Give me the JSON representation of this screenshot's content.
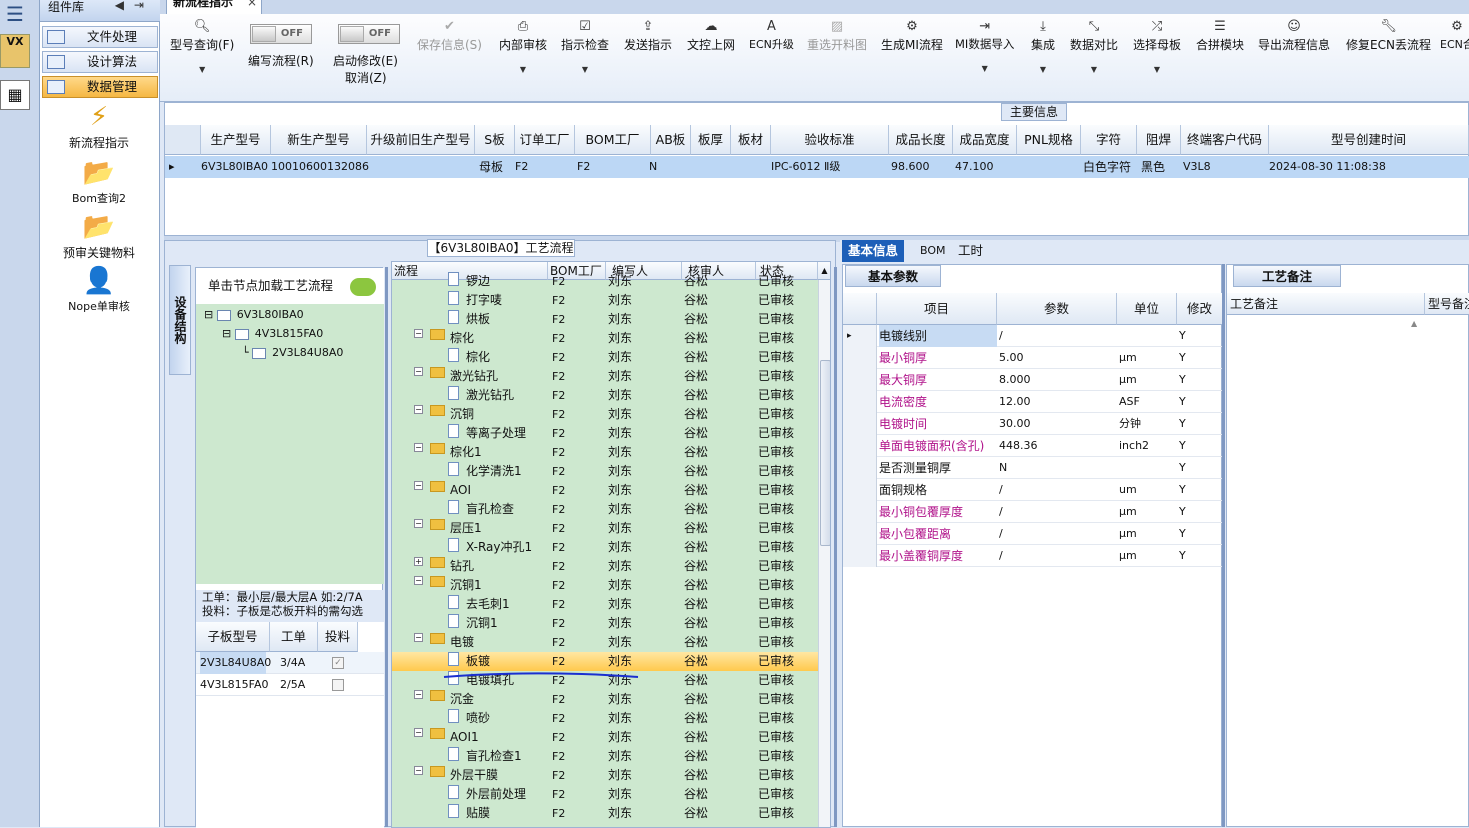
{
  "component_lib": {
    "title": "组件库",
    "groups": [
      "文件处理",
      "设计算法",
      "数据管理"
    ],
    "tools": [
      "新流程指示",
      "Bom查询2",
      "预审关键物料",
      "Nope单审核"
    ]
  },
  "side_strip": {
    "icon1_text": "VX"
  },
  "doc_tab": {
    "label": "新流程指示",
    "close": "×"
  },
  "ribbon": {
    "type_query": "型号查询(F)",
    "edit_flow": "编写流程(R)",
    "toggle_off": "OFF",
    "start_modify": "启动修改(E)",
    "cancel": "取消(Z)",
    "save_info": "保存信息(S)",
    "internal_review": "内部审核",
    "instruction_check": "指示检查",
    "send_instruction": "发送指示",
    "upload": "文控上网",
    "ecn_upgrade": "ECN升级",
    "reselect_cut": "重选开料图",
    "generate_mi": "生成MI流程",
    "mi_import": "MI数据导入",
    "integrate": "集成",
    "compare": "数据对比",
    "select_master": "选择母板",
    "merge_module": "合拼模块",
    "export_flow": "导出流程信息",
    "repair_ecn": "修复ECN丢流程",
    "ecn_short": "ECN合"
  },
  "main_info": {
    "caption": "主要信息",
    "columns": [
      "生产型号",
      "新生产型号",
      "升级前旧生产型号",
      "S板",
      "订单工厂",
      "BOM工厂",
      "AB板",
      "板厚",
      "板材",
      "验收标准",
      "成品长度",
      "成品宽度",
      "PNL规格",
      "字符",
      "阻焊",
      "终端客户代码",
      "型号创建时间"
    ],
    "row": {
      "prod_model": "6V3L80IBA0",
      "new_model": "10010600132086",
      "old_model": "",
      "s_board": "母板",
      "order_factory": "F2",
      "bom_factory": "F2",
      "ab_board": "N",
      "thickness": "",
      "material": "",
      "standard": "IPC-6012 Ⅱ级",
      "length": "98.600",
      "width": "47.100",
      "pnl": "",
      "char": "白色字符",
      "mask": "黑色",
      "customer": "V3L8",
      "created": "2024-08-30 11:08:38"
    }
  },
  "workflow": {
    "caption": "【6V3L80IBA0】工艺流程",
    "vtab": "设备结构",
    "hint": "单击节点加载工艺流程",
    "tree": [
      "6V3L80IBA0",
      "4V3L815FA0",
      "2V3L84U8A0"
    ],
    "instruction_1": "工单：最小层/最大层A 如:2/7A",
    "instruction_2": "投料：子板是芯板开料的需勾选",
    "sub_columns": [
      "子板型号",
      "工单",
      "投料"
    ],
    "sub_rows": [
      {
        "model": "2V3L84U8A0",
        "order": "3/4A",
        "checked": true
      },
      {
        "model": "4V3L815FA0",
        "order": "2/5A",
        "checked": false
      }
    ],
    "flow_columns": [
      "流程",
      "BOM工厂",
      "编写人",
      "核审人",
      "状态"
    ],
    "flow_rows": [
      {
        "name": "锣边",
        "level": 1,
        "factory": "F2",
        "writer": "刘东",
        "reviewer": "谷松",
        "status": "已审核"
      },
      {
        "name": "打字唛",
        "level": 1,
        "factory": "F2",
        "writer": "刘东",
        "reviewer": "谷松",
        "status": "已审核"
      },
      {
        "name": "烘板",
        "level": 1,
        "factory": "F2",
        "writer": "刘东",
        "reviewer": "谷松",
        "status": "已审核"
      },
      {
        "name": "棕化",
        "level": 0,
        "factory": "F2",
        "writer": "刘东",
        "reviewer": "谷松",
        "status": "已审核"
      },
      {
        "name": "棕化",
        "level": 1,
        "factory": "F2",
        "writer": "刘东",
        "reviewer": "谷松",
        "status": "已审核"
      },
      {
        "name": "激光钻孔",
        "level": 0,
        "factory": "F2",
        "writer": "刘东",
        "reviewer": "谷松",
        "status": "已审核"
      },
      {
        "name": "激光钻孔",
        "level": 1,
        "factory": "F2",
        "writer": "刘东",
        "reviewer": "谷松",
        "status": "已审核"
      },
      {
        "name": "沉铜",
        "level": 0,
        "factory": "F2",
        "writer": "刘东",
        "reviewer": "谷松",
        "status": "已审核"
      },
      {
        "name": "等离子处理",
        "level": 1,
        "factory": "F2",
        "writer": "刘东",
        "reviewer": "谷松",
        "status": "已审核"
      },
      {
        "name": "棕化1",
        "level": 0,
        "factory": "F2",
        "writer": "刘东",
        "reviewer": "谷松",
        "status": "已审核"
      },
      {
        "name": "化学清洗1",
        "level": 1,
        "factory": "F2",
        "writer": "刘东",
        "reviewer": "谷松",
        "status": "已审核"
      },
      {
        "name": "AOI",
        "level": 0,
        "factory": "F2",
        "writer": "刘东",
        "reviewer": "谷松",
        "status": "已审核"
      },
      {
        "name": "盲孔检查",
        "level": 1,
        "factory": "F2",
        "writer": "刘东",
        "reviewer": "谷松",
        "status": "已审核"
      },
      {
        "name": "层压1",
        "level": 0,
        "factory": "F2",
        "writer": "刘东",
        "reviewer": "谷松",
        "status": "已审核"
      },
      {
        "name": "X-Ray冲孔1",
        "level": 1,
        "factory": "F2",
        "writer": "刘东",
        "reviewer": "谷松",
        "status": "已审核"
      },
      {
        "name": "钻孔",
        "level": 0,
        "factory": "F2",
        "writer": "刘东",
        "reviewer": "谷松",
        "status": "已审核",
        "expander": "+"
      },
      {
        "name": "沉铜1",
        "level": 0,
        "factory": "F2",
        "writer": "刘东",
        "reviewer": "谷松",
        "status": "已审核"
      },
      {
        "name": "去毛刺1",
        "level": 1,
        "factory": "F2",
        "writer": "刘东",
        "reviewer": "谷松",
        "status": "已审核"
      },
      {
        "name": "沉铜1",
        "level": 1,
        "factory": "F2",
        "writer": "刘东",
        "reviewer": "谷松",
        "status": "已审核"
      },
      {
        "name": "电镀",
        "level": 0,
        "factory": "F2",
        "writer": "刘东",
        "reviewer": "谷松",
        "status": "已审核"
      },
      {
        "name": "板镀",
        "level": 1,
        "factory": "F2",
        "writer": "刘东",
        "reviewer": "谷松",
        "status": "已审核",
        "selected": true
      },
      {
        "name": "电镀填孔",
        "level": 1,
        "factory": "F2",
        "writer": "刘东",
        "reviewer": "谷松",
        "status": "已审核"
      },
      {
        "name": "沉金",
        "level": 0,
        "factory": "F2",
        "writer": "刘东",
        "reviewer": "谷松",
        "status": "已审核"
      },
      {
        "name": "喷砂",
        "level": 1,
        "factory": "F2",
        "writer": "刘东",
        "reviewer": "谷松",
        "status": "已审核"
      },
      {
        "name": "AOI1",
        "level": 0,
        "factory": "F2",
        "writer": "刘东",
        "reviewer": "谷松",
        "status": "已审核"
      },
      {
        "name": "盲孔检查1",
        "level": 1,
        "factory": "F2",
        "writer": "刘东",
        "reviewer": "谷松",
        "status": "已审核"
      },
      {
        "name": "外层干膜",
        "level": 0,
        "factory": "F2",
        "writer": "刘东",
        "reviewer": "谷松",
        "status": "已审核"
      },
      {
        "name": "外层前处理",
        "level": 1,
        "factory": "F2",
        "writer": "刘东",
        "reviewer": "谷松",
        "status": "已审核"
      },
      {
        "name": "贴膜",
        "level": 1,
        "factory": "F2",
        "writer": "刘东",
        "reviewer": "谷松",
        "status": "已审核"
      }
    ]
  },
  "right_panel": {
    "tabs": [
      "基本信息",
      "BOM",
      "工时"
    ],
    "basic_caption": "基本参数",
    "columns": [
      "项目",
      "参数",
      "单位",
      "修改"
    ],
    "rows": [
      {
        "item": "电镀线别",
        "param": "/",
        "unit": "",
        "mod": "Y",
        "highlight": false
      },
      {
        "item": "最小铜厚",
        "param": "5.00",
        "unit": "μm",
        "mod": "Y",
        "highlight": true
      },
      {
        "item": "最大铜厚",
        "param": "8.000",
        "unit": "μm",
        "mod": "Y",
        "highlight": true
      },
      {
        "item": "电流密度",
        "param": "12.00",
        "unit": "ASF",
        "mod": "Y",
        "highlight": true
      },
      {
        "item": "电镀时间",
        "param": "30.00",
        "unit": "分钟",
        "mod": "Y",
        "highlight": true
      },
      {
        "item": "单面电镀面积(含孔)",
        "param": "448.36",
        "unit": "inch2",
        "mod": "Y",
        "highlight": true
      },
      {
        "item": "是否测量铜厚",
        "param": "N",
        "unit": "",
        "mod": "Y",
        "highlight": false
      },
      {
        "item": "面铜规格",
        "param": "/",
        "unit": "um",
        "mod": "Y",
        "highlight": false
      },
      {
        "item": "最小铜包覆厚度",
        "param": "/",
        "unit": "μm",
        "mod": "Y",
        "highlight": true
      },
      {
        "item": "最小包覆距离",
        "param": "/",
        "unit": "μm",
        "mod": "Y",
        "highlight": true
      },
      {
        "item": "最小盖覆铜厚度",
        "param": "/",
        "unit": "μm",
        "mod": "Y",
        "highlight": true
      }
    ],
    "memo_caption": "工艺备注",
    "memo_columns": [
      "工艺备注",
      "型号备注"
    ]
  }
}
